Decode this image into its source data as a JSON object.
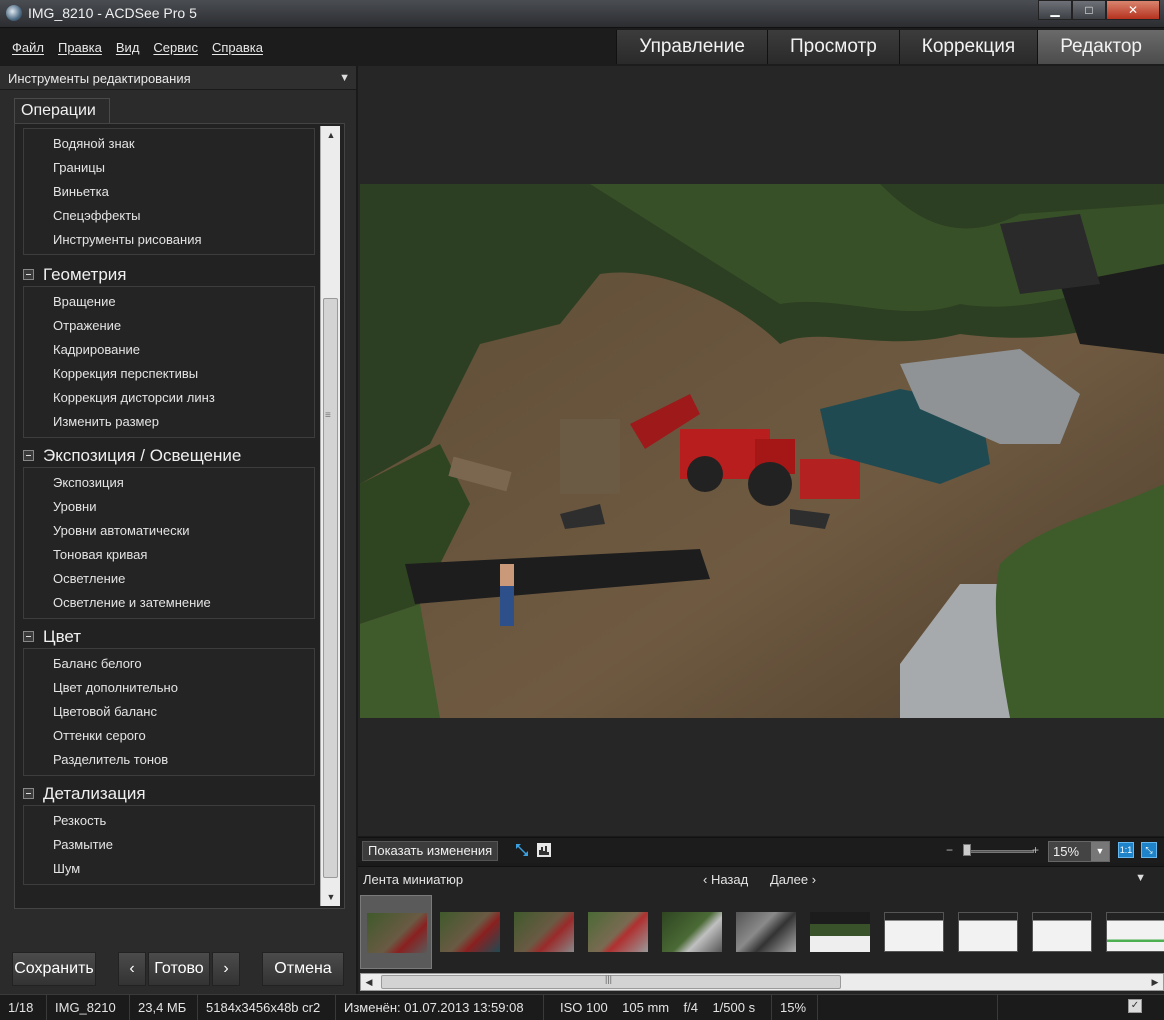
{
  "window": {
    "title": "IMG_8210 - ACDSee Pro 5",
    "minimize": "▁",
    "maximize": "□",
    "close": "✕"
  },
  "menu": {
    "items": [
      "Файл",
      "Правка",
      "Вид",
      "Сервис",
      "Справка"
    ]
  },
  "modes": {
    "items": [
      "Управление",
      "Просмотр",
      "Коррекция",
      "Редактор"
    ],
    "active": "Редактор"
  },
  "panel": {
    "header": "Инструменты редактирования",
    "tab": "Операции",
    "top_items": [
      "Водяной знак",
      "Границы",
      "Виньетка",
      "Спецэффекты",
      "Инструменты рисования"
    ],
    "groups": [
      {
        "title": "Геометрия",
        "items": [
          "Вращение",
          "Отражение",
          "Кадрирование",
          "Коррекция перспективы",
          "Коррекция дисторсии линз",
          "Изменить размер"
        ]
      },
      {
        "title": "Экспозиция / Освещение",
        "items": [
          "Экспозиция",
          "Уровни",
          "Уровни автоматически",
          "Тоновая кривая",
          "Осветление",
          "Осветление и затемнение"
        ]
      },
      {
        "title": "Цвет",
        "items": [
          "Баланс белого",
          "Цвет дополнительно",
          "Цветовой баланс",
          "Оттенки серого",
          "Разделитель тонов"
        ]
      },
      {
        "title": "Детализация",
        "items": [
          "Резкость",
          "Размытие",
          "Шум"
        ]
      }
    ],
    "buttons": {
      "save": "Сохранить",
      "done": "Готово",
      "cancel": "Отмена",
      "prev": "‹",
      "next": "›"
    }
  },
  "viewbar": {
    "show_changes": "Показать изменения",
    "zoom": "15%",
    "zoom_minus": "−",
    "zoom_plus": "+",
    "one_to_one": "1:1"
  },
  "filmstrip": {
    "title": "Лента миниатюр",
    "prev": "‹ Назад",
    "next": "Далее ›",
    "thumbnail_count": 11,
    "selected_index": 0
  },
  "status": {
    "position": "1/18",
    "filename": "IMG_8210",
    "size": "23,4 МБ",
    "dims": "5184x3456x48b cr2",
    "modified": "Изменён: 01.07.2013 13:59:08",
    "exif": "ISO 100    105 mm    f/4    1/500 s",
    "zoom": "15%"
  }
}
